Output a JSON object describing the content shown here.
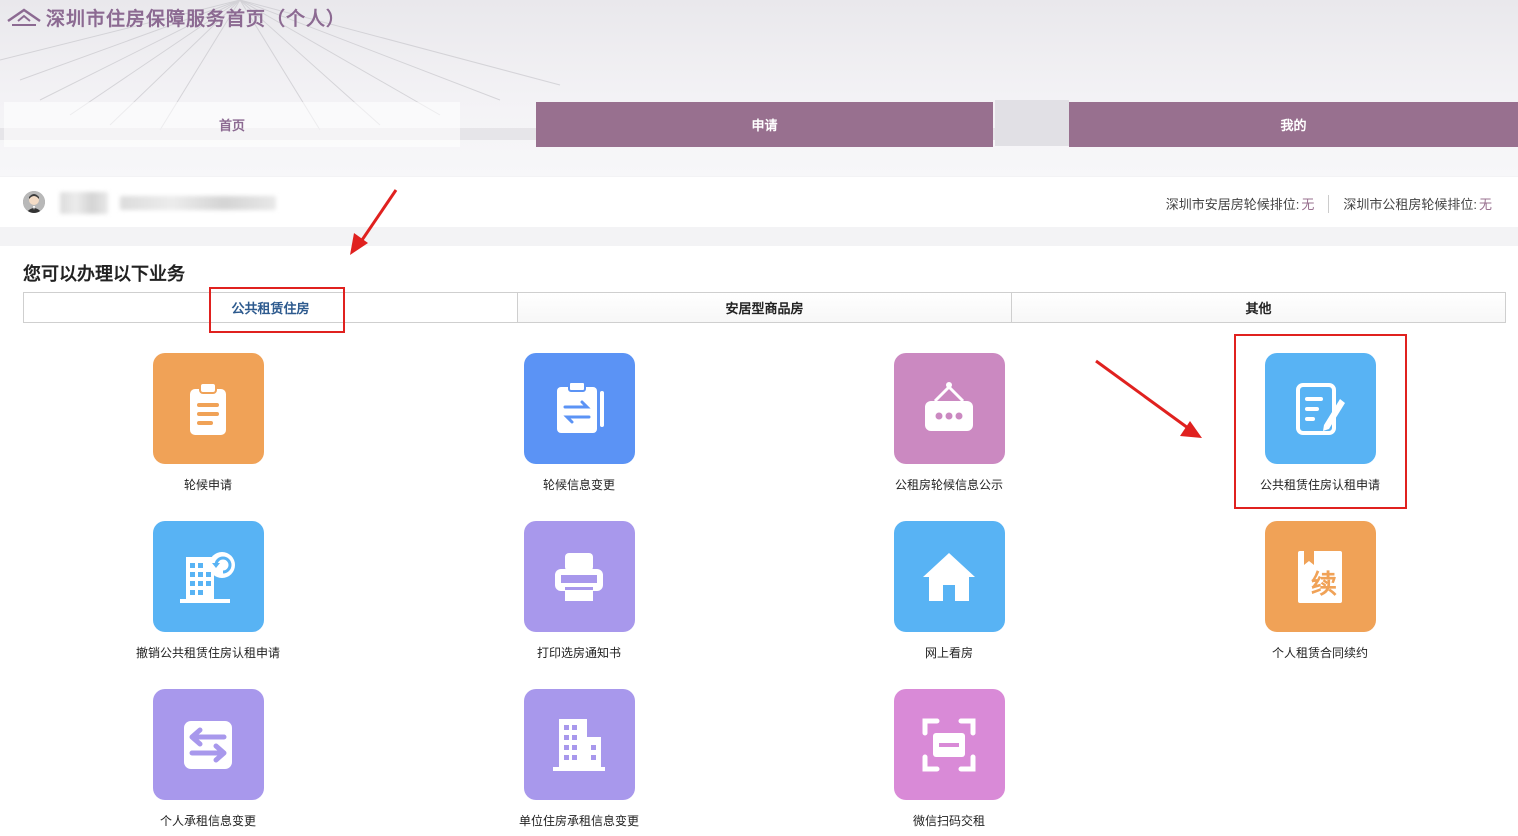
{
  "header": {
    "title": "深圳市住房保障服务首页（个人）",
    "nav": [
      "首页",
      "申请",
      "我的"
    ]
  },
  "user_bar": {
    "queue_anju_label": "深圳市安居房轮候排位:",
    "queue_anju_value": "无",
    "queue_gongzu_label": "深圳市公租房轮候排位:",
    "queue_gongzu_value": "无"
  },
  "main": {
    "title": "您可以办理以下业务",
    "tabs": [
      "公共租赁住房",
      "安居型商品房",
      "其他"
    ],
    "services": [
      {
        "label": "轮候申请",
        "icon": "clipboard-list-icon",
        "color": "#f0a257"
      },
      {
        "label": "轮候信息变更",
        "icon": "clipboard-exchange-icon",
        "color": "#5b93f5"
      },
      {
        "label": "公租房轮候信息公示",
        "icon": "hanging-sign-icon",
        "color": "#cb89c1"
      },
      {
        "label": "公共租赁住房认租申请",
        "icon": "document-edit-icon",
        "color": "#58b3f4"
      },
      {
        "label": "撤销公共租赁住房认租申请",
        "icon": "building-undo-icon",
        "color": "#58b3f4"
      },
      {
        "label": "打印选房通知书",
        "icon": "printer-icon",
        "color": "#a898ec"
      },
      {
        "label": "网上看房",
        "icon": "house-icon",
        "color": "#58b3f4"
      },
      {
        "label": "个人租赁合同续约",
        "icon": "renew-book-icon",
        "color": "#f0a257"
      },
      {
        "label": "个人承租信息变更",
        "icon": "swap-arrows-icon",
        "color": "#a898ec"
      },
      {
        "label": "单位住房承租信息变更",
        "icon": "office-building-icon",
        "color": "#a898ec"
      },
      {
        "label": "微信扫码交租",
        "icon": "scan-qr-icon",
        "color": "#d98ad7"
      }
    ],
    "renew_char": "续"
  },
  "colors": {
    "brand": "#98708f",
    "highlight": "#e0211f"
  }
}
